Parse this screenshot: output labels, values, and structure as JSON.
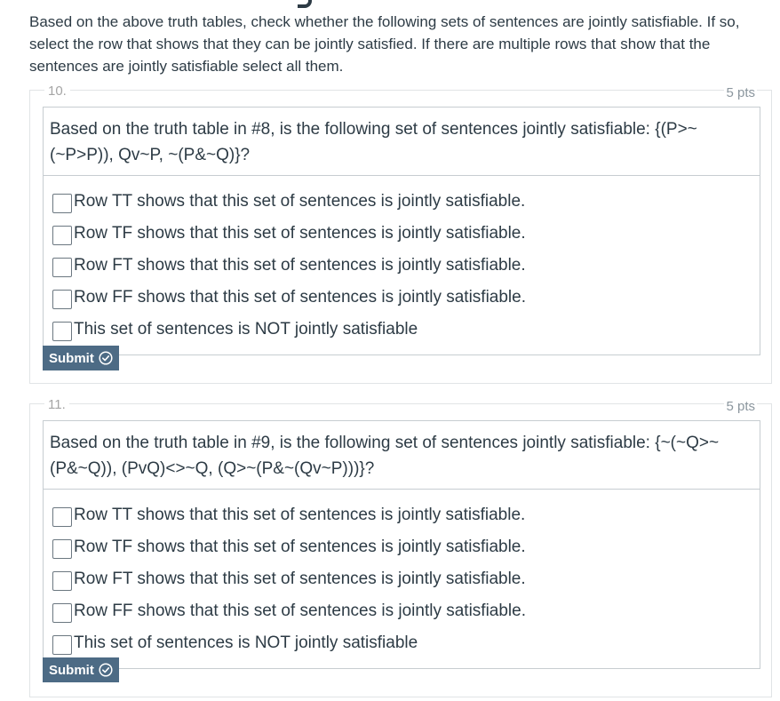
{
  "intro": "Based on the above truth tables, check whether the following sets of sentences are jointly satisfiable. If so, select the row that shows that they can be jointly satisfied. If there are multiple rows that show that the sentences are jointly satisfiable select all them.",
  "questions": [
    {
      "number": "10.",
      "points": "5 pts",
      "text": "Based on the truth table in #8, is the following set of sentences jointly satisfiable: {(P>~(~P>P)), Qv~P, ~(P&~Q)}?",
      "answers": [
        "Row TT shows that this set of sentences is jointly satisfiable.",
        "Row TF shows that this set of sentences is jointly satisfiable.",
        "Row FT shows that this set of sentences is jointly satisfiable.",
        "Row FF shows that this set of sentences is jointly satisfiable.",
        "This set of sentences is NOT jointly satisfiable"
      ],
      "submit_label": "Submit"
    },
    {
      "number": "11.",
      "points": "5 pts",
      "text": "Based on the truth table in #9, is the following set of sentences jointly satisfiable: {~(~Q>~(P&~Q)), (PvQ)<>~Q, (Q>~(P&~(Qv~P)))}?",
      "answers": [
        "Row TT shows that this set of sentences is jointly satisfiable.",
        "Row TF shows that this set of sentences is jointly satisfiable.",
        "Row FT shows that this set of sentences is jointly satisfiable.",
        "Row FF shows that this set of sentences is jointly satisfiable.",
        "This set of sentences is NOT jointly satisfiable"
      ],
      "submit_label": "Submit"
    }
  ],
  "icons": {
    "submit": "check-circle-icon",
    "checkbox": "checkbox-unchecked"
  },
  "colors": {
    "submit_bg": "#4d6b85",
    "text": "#2d3b45",
    "border": "#c7cdd1"
  }
}
